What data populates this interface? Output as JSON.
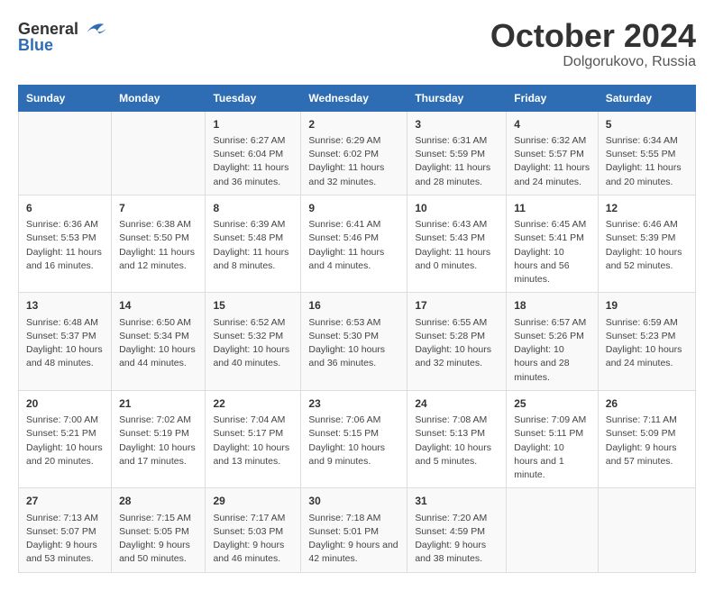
{
  "logo": {
    "general": "General",
    "blue": "Blue"
  },
  "title": "October 2024",
  "location": "Dolgorukovo, Russia",
  "weekdays": [
    "Sunday",
    "Monday",
    "Tuesday",
    "Wednesday",
    "Thursday",
    "Friday",
    "Saturday"
  ],
  "weeks": [
    [
      {
        "day": "",
        "sunrise": "",
        "sunset": "",
        "daylight": ""
      },
      {
        "day": "",
        "sunrise": "",
        "sunset": "",
        "daylight": ""
      },
      {
        "day": "1",
        "sunrise": "Sunrise: 6:27 AM",
        "sunset": "Sunset: 6:04 PM",
        "daylight": "Daylight: 11 hours and 36 minutes."
      },
      {
        "day": "2",
        "sunrise": "Sunrise: 6:29 AM",
        "sunset": "Sunset: 6:02 PM",
        "daylight": "Daylight: 11 hours and 32 minutes."
      },
      {
        "day": "3",
        "sunrise": "Sunrise: 6:31 AM",
        "sunset": "Sunset: 5:59 PM",
        "daylight": "Daylight: 11 hours and 28 minutes."
      },
      {
        "day": "4",
        "sunrise": "Sunrise: 6:32 AM",
        "sunset": "Sunset: 5:57 PM",
        "daylight": "Daylight: 11 hours and 24 minutes."
      },
      {
        "day": "5",
        "sunrise": "Sunrise: 6:34 AM",
        "sunset": "Sunset: 5:55 PM",
        "daylight": "Daylight: 11 hours and 20 minutes."
      }
    ],
    [
      {
        "day": "6",
        "sunrise": "Sunrise: 6:36 AM",
        "sunset": "Sunset: 5:53 PM",
        "daylight": "Daylight: 11 hours and 16 minutes."
      },
      {
        "day": "7",
        "sunrise": "Sunrise: 6:38 AM",
        "sunset": "Sunset: 5:50 PM",
        "daylight": "Daylight: 11 hours and 12 minutes."
      },
      {
        "day": "8",
        "sunrise": "Sunrise: 6:39 AM",
        "sunset": "Sunset: 5:48 PM",
        "daylight": "Daylight: 11 hours and 8 minutes."
      },
      {
        "day": "9",
        "sunrise": "Sunrise: 6:41 AM",
        "sunset": "Sunset: 5:46 PM",
        "daylight": "Daylight: 11 hours and 4 minutes."
      },
      {
        "day": "10",
        "sunrise": "Sunrise: 6:43 AM",
        "sunset": "Sunset: 5:43 PM",
        "daylight": "Daylight: 11 hours and 0 minutes."
      },
      {
        "day": "11",
        "sunrise": "Sunrise: 6:45 AM",
        "sunset": "Sunset: 5:41 PM",
        "daylight": "Daylight: 10 hours and 56 minutes."
      },
      {
        "day": "12",
        "sunrise": "Sunrise: 6:46 AM",
        "sunset": "Sunset: 5:39 PM",
        "daylight": "Daylight: 10 hours and 52 minutes."
      }
    ],
    [
      {
        "day": "13",
        "sunrise": "Sunrise: 6:48 AM",
        "sunset": "Sunset: 5:37 PM",
        "daylight": "Daylight: 10 hours and 48 minutes."
      },
      {
        "day": "14",
        "sunrise": "Sunrise: 6:50 AM",
        "sunset": "Sunset: 5:34 PM",
        "daylight": "Daylight: 10 hours and 44 minutes."
      },
      {
        "day": "15",
        "sunrise": "Sunrise: 6:52 AM",
        "sunset": "Sunset: 5:32 PM",
        "daylight": "Daylight: 10 hours and 40 minutes."
      },
      {
        "day": "16",
        "sunrise": "Sunrise: 6:53 AM",
        "sunset": "Sunset: 5:30 PM",
        "daylight": "Daylight: 10 hours and 36 minutes."
      },
      {
        "day": "17",
        "sunrise": "Sunrise: 6:55 AM",
        "sunset": "Sunset: 5:28 PM",
        "daylight": "Daylight: 10 hours and 32 minutes."
      },
      {
        "day": "18",
        "sunrise": "Sunrise: 6:57 AM",
        "sunset": "Sunset: 5:26 PM",
        "daylight": "Daylight: 10 hours and 28 minutes."
      },
      {
        "day": "19",
        "sunrise": "Sunrise: 6:59 AM",
        "sunset": "Sunset: 5:23 PM",
        "daylight": "Daylight: 10 hours and 24 minutes."
      }
    ],
    [
      {
        "day": "20",
        "sunrise": "Sunrise: 7:00 AM",
        "sunset": "Sunset: 5:21 PM",
        "daylight": "Daylight: 10 hours and 20 minutes."
      },
      {
        "day": "21",
        "sunrise": "Sunrise: 7:02 AM",
        "sunset": "Sunset: 5:19 PM",
        "daylight": "Daylight: 10 hours and 17 minutes."
      },
      {
        "day": "22",
        "sunrise": "Sunrise: 7:04 AM",
        "sunset": "Sunset: 5:17 PM",
        "daylight": "Daylight: 10 hours and 13 minutes."
      },
      {
        "day": "23",
        "sunrise": "Sunrise: 7:06 AM",
        "sunset": "Sunset: 5:15 PM",
        "daylight": "Daylight: 10 hours and 9 minutes."
      },
      {
        "day": "24",
        "sunrise": "Sunrise: 7:08 AM",
        "sunset": "Sunset: 5:13 PM",
        "daylight": "Daylight: 10 hours and 5 minutes."
      },
      {
        "day": "25",
        "sunrise": "Sunrise: 7:09 AM",
        "sunset": "Sunset: 5:11 PM",
        "daylight": "Daylight: 10 hours and 1 minute."
      },
      {
        "day": "26",
        "sunrise": "Sunrise: 7:11 AM",
        "sunset": "Sunset: 5:09 PM",
        "daylight": "Daylight: 9 hours and 57 minutes."
      }
    ],
    [
      {
        "day": "27",
        "sunrise": "Sunrise: 7:13 AM",
        "sunset": "Sunset: 5:07 PM",
        "daylight": "Daylight: 9 hours and 53 minutes."
      },
      {
        "day": "28",
        "sunrise": "Sunrise: 7:15 AM",
        "sunset": "Sunset: 5:05 PM",
        "daylight": "Daylight: 9 hours and 50 minutes."
      },
      {
        "day": "29",
        "sunrise": "Sunrise: 7:17 AM",
        "sunset": "Sunset: 5:03 PM",
        "daylight": "Daylight: 9 hours and 46 minutes."
      },
      {
        "day": "30",
        "sunrise": "Sunrise: 7:18 AM",
        "sunset": "Sunset: 5:01 PM",
        "daylight": "Daylight: 9 hours and 42 minutes."
      },
      {
        "day": "31",
        "sunrise": "Sunrise: 7:20 AM",
        "sunset": "Sunset: 4:59 PM",
        "daylight": "Daylight: 9 hours and 38 minutes."
      },
      {
        "day": "",
        "sunrise": "",
        "sunset": "",
        "daylight": ""
      },
      {
        "day": "",
        "sunrise": "",
        "sunset": "",
        "daylight": ""
      }
    ]
  ]
}
